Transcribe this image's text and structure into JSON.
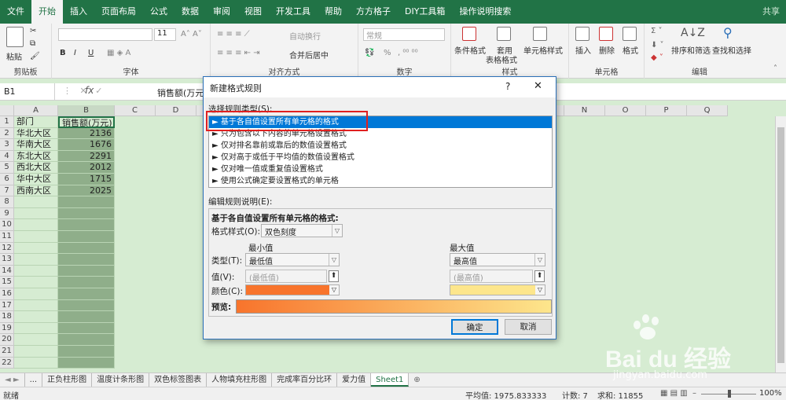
{
  "ribbon_tabs": [
    "文件",
    "开始",
    "插入",
    "页面布局",
    "公式",
    "数据",
    "审阅",
    "视图",
    "开发工具",
    "帮助",
    "方方格子",
    "DIY工具箱",
    "操作说明搜索"
  ],
  "share": "共享",
  "ribbon": {
    "clipboard": {
      "paste": "粘贴",
      "label": "剪贴板"
    },
    "font": {
      "size": "11",
      "label": "字体",
      "bold": "B",
      "italic": "I",
      "underline": "U"
    },
    "align": {
      "wrap": "自动换行",
      "merge": "合并后居中",
      "label": "对齐方式"
    },
    "number": {
      "format": "常规",
      "label": "数字",
      "pct": "%"
    },
    "styles": {
      "cond": "条件格式",
      "table1": "套用",
      "table2": "表格格式",
      "cell": "单元格样式",
      "label": "样式"
    },
    "cells": {
      "insert": "插入",
      "delete": "删除",
      "format": "格式",
      "label": "单元格"
    },
    "edit": {
      "sort": "排序和筛选",
      "find": "查找和选择",
      "label": "编辑"
    }
  },
  "formula_bar": {
    "name_box": "B1",
    "fx": "fx",
    "content": "销售额(万元"
  },
  "columns": [
    "A",
    "B",
    "C",
    "D",
    "E",
    "F",
    "G",
    "H",
    "I",
    "J",
    "K",
    "L",
    "M",
    "N",
    "O",
    "P",
    "Q"
  ],
  "rows": [
    "1",
    "2",
    "3",
    "4",
    "5",
    "6",
    "7",
    "8",
    "9",
    "10",
    "11",
    "12",
    "13",
    "14",
    "15",
    "16",
    "17",
    "18",
    "19",
    "20",
    "21",
    "22"
  ],
  "table": {
    "header": [
      "部门",
      "销售额(万元)"
    ],
    "data": [
      [
        "华北大区",
        "2136"
      ],
      [
        "华南大区",
        "1676"
      ],
      [
        "东北大区",
        "2291"
      ],
      [
        "西北大区",
        "2012"
      ],
      [
        "华中大区",
        "1715"
      ],
      [
        "西南大区",
        "2025"
      ]
    ]
  },
  "sheet_tabs": [
    "...",
    "正负柱形图",
    "温度计条形图",
    "双色标签图表",
    "人物填充柱形图",
    "完成率百分比环",
    "爱力值",
    "Sheet1"
  ],
  "status": {
    "mode": "就绪",
    "avg": "平均值: 1975.833333",
    "count": "计数: 7",
    "sum": "求和: 11855",
    "zoom": "100%"
  },
  "dialog": {
    "title": "新建格式规则",
    "help": "?",
    "close": "✕",
    "select_label": "选择规则类型(S):",
    "rules": [
      "► 基于各自值设置所有单元格的格式",
      "► 只为包含以下内容的单元格设置格式",
      "► 仅对排名靠前或靠后的数值设置格式",
      "► 仅对高于或低于平均值的数值设置格式",
      "► 仅对唯一值或重复值设置格式",
      "► 使用公式确定要设置格式的单元格"
    ],
    "edit_label": "编辑规则说明(E):",
    "edit_title": "基于各自值设置所有单元格的格式:",
    "format_style_label": "格式样式(O):",
    "format_style": "双色刻度",
    "min_header": "最小值",
    "max_header": "最大值",
    "type_label": "类型(T):",
    "min_type": "最低值",
    "max_type": "最高值",
    "value_label": "值(V):",
    "min_value": "(最低值)",
    "max_value": "(最高值)",
    "color_label": "颜色(C):",
    "min_color": "#f8742c",
    "max_color": "#fde68c",
    "preview_label": "预览:",
    "ok": "确定",
    "cancel": "取消"
  },
  "watermark": {
    "brand": "Bai du 经验",
    "url": "jingyan.baidu.com"
  }
}
